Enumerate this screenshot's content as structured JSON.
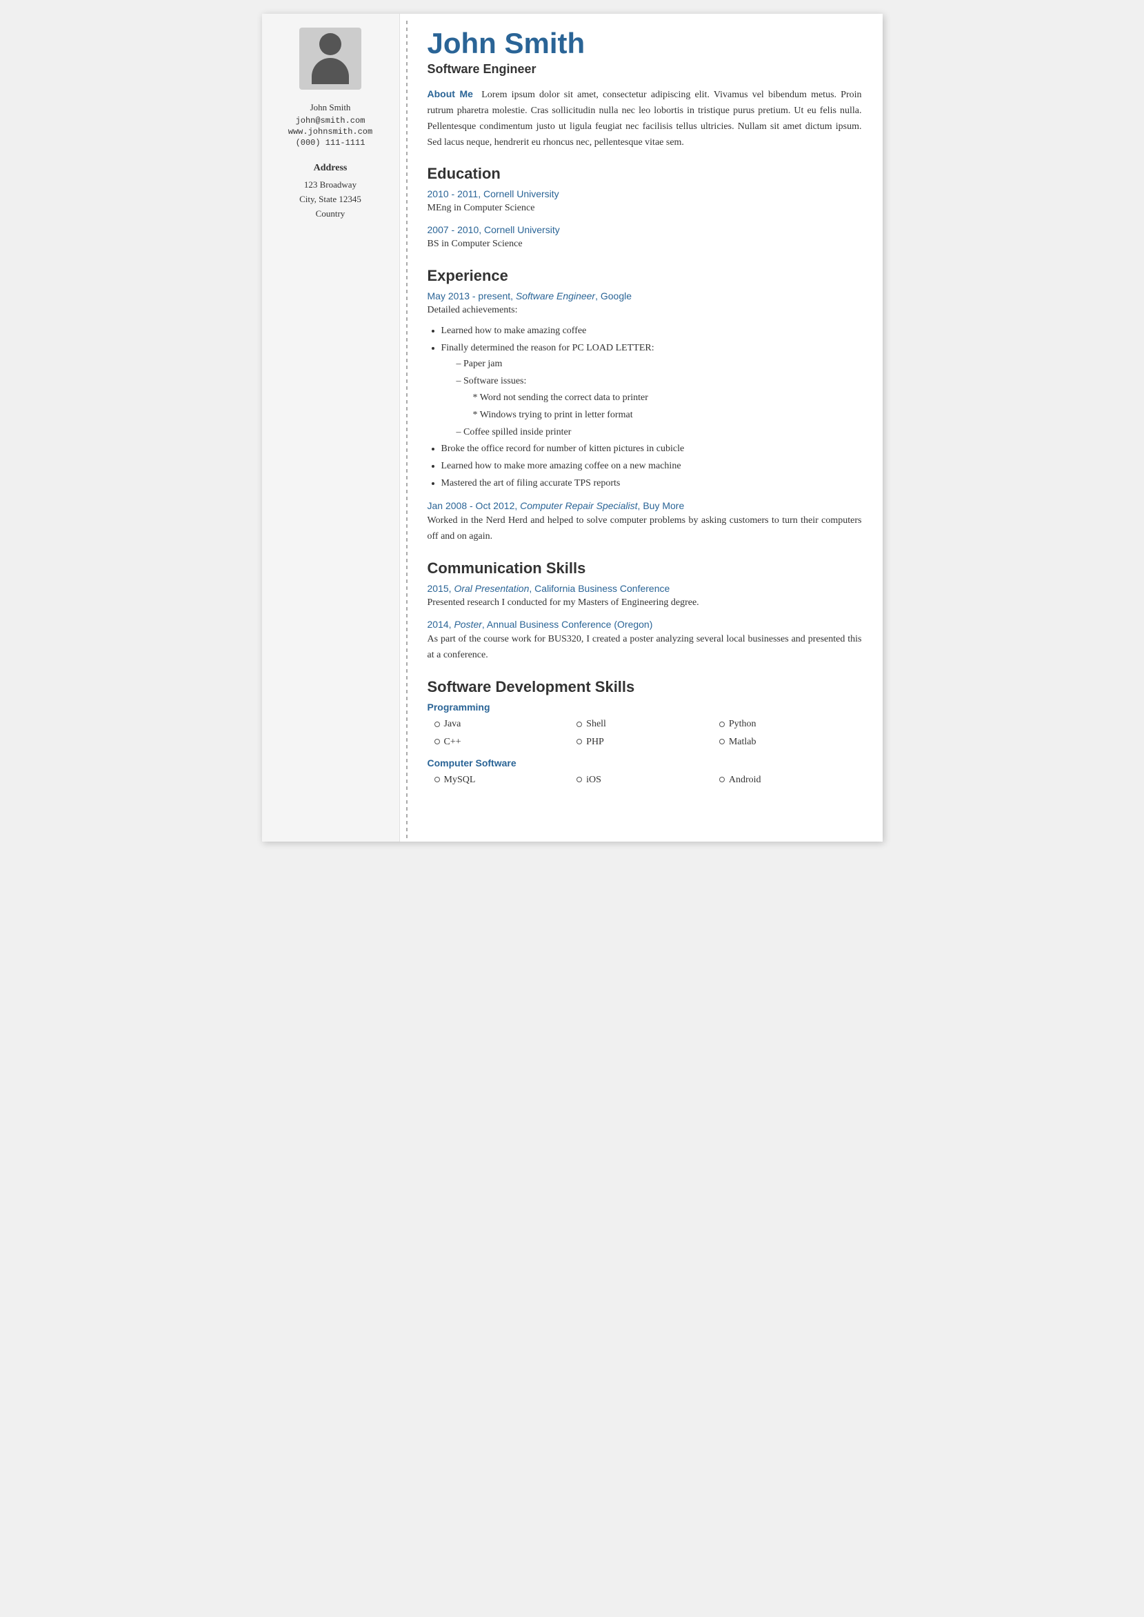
{
  "sidebar": {
    "name": "John Smith",
    "email": "john@smith.com",
    "website": "www.johnsmith.com",
    "phone": "(000) 111-1111",
    "address_label": "Address",
    "address_line1": "123 Broadway",
    "address_line2": "City, State 12345",
    "address_line3": "Country"
  },
  "main": {
    "name": "John Smith",
    "job_title": "Software Engineer",
    "about_me_label": "About Me",
    "about_me_text": "Lorem ipsum dolor sit amet, consectetur adipiscing elit. Vivamus vel bibendum metus. Proin rutrum pharetra molestie. Cras sollicitudin nulla nec leo lobortis in tristique purus pretium. Ut eu felis nulla. Pellentesque condimentum justo ut ligula feugiat nec facilisis tellus ultricies. Nullam sit amet dictum ipsum. Sed lacus neque, hendrerit eu rhoncus nec, pellentesque vitae sem.",
    "education_label": "Education",
    "education_entries": [
      {
        "period_school": "2010 - 2011, Cornell University",
        "degree": "MEng in Computer Science"
      },
      {
        "period_school": "2007 - 2010, Cornell University",
        "degree": "BS in Computer Science"
      }
    ],
    "experience_label": "Experience",
    "experience_entries": [
      {
        "title": "May 2013 - present, Software Engineer, Google",
        "desc_intro": "Detailed achievements:",
        "bullets": [
          "Learned how to make amazing coffee",
          "Finally determined the reason for PC LOAD LETTER:"
        ],
        "sub_bullets_index": 1,
        "sub_bullets": [
          "Paper jam",
          "Software issues:"
        ],
        "sub_sub_bullets": [
          "Word not sending the correct data to printer",
          "Windows trying to print in letter format"
        ],
        "sub_bullet_extra": "Coffee spilled inside printer",
        "more_bullets": [
          "Broke the office record for number of kitten pictures in cubicle",
          "Learned how to make more amazing coffee on a new machine",
          "Mastered the art of filing accurate TPS reports"
        ]
      },
      {
        "title": "Jan 2008 - Oct 2012, Computer Repair Specialist, Buy More",
        "desc": "Worked in the Nerd Herd and helped to solve computer problems by asking customers to turn their computers off and on again."
      }
    ],
    "comm_skills_label": "Communication Skills",
    "comm_skills_entries": [
      {
        "title": "2015, Oral Presentation, California Business Conference",
        "desc": "Presented research I conducted for my Masters of Engineering degree."
      },
      {
        "title": "2014, Poster, Annual Business Conference (Oregon)",
        "desc": "As part of the course work for BUS320, I created a poster analyzing several local businesses and presented this at a conference."
      }
    ],
    "software_skills_label": "Software Development Skills",
    "skills_categories": [
      {
        "label": "Programming",
        "skills": [
          "Java",
          "C++",
          "Shell",
          "PHP",
          "Python",
          "Matlab"
        ]
      },
      {
        "label": "Computer Software",
        "skills": [
          "MySQL",
          "iOS",
          "Android"
        ]
      }
    ]
  }
}
